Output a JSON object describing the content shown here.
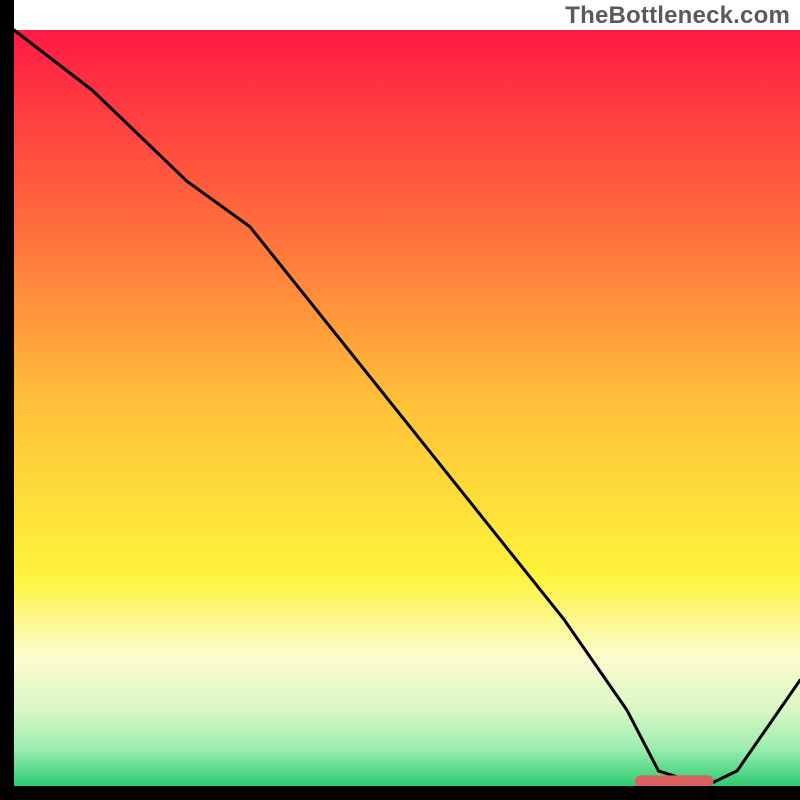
{
  "watermark": "TheBottleneck.com",
  "chart_data": {
    "type": "line",
    "title": "",
    "xlabel": "",
    "ylabel": "",
    "xlim": [
      0,
      100
    ],
    "ylim": [
      0,
      100
    ],
    "background_gradient": {
      "stops": [
        {
          "offset": 0,
          "color": "#ff1a44"
        },
        {
          "offset": 25,
          "color": "#ff6a3c"
        },
        {
          "offset": 50,
          "color": "#ffc23a"
        },
        {
          "offset": 72,
          "color": "#fef33a"
        },
        {
          "offset": 83,
          "color": "#fcfccf"
        },
        {
          "offset": 90,
          "color": "#d9f7c4"
        },
        {
          "offset": 95,
          "color": "#9dedb0"
        },
        {
          "offset": 100,
          "color": "#2ecb70"
        }
      ]
    },
    "series": [
      {
        "name": "curve",
        "color": "#000000",
        "stroke_width": 3,
        "x": [
          0,
          10,
          22,
          30,
          40,
          50,
          60,
          70,
          78,
          82,
          88,
          92,
          100
        ],
        "y": [
          100,
          92,
          80,
          74,
          61,
          48,
          35,
          22,
          10,
          2,
          0,
          2,
          14
        ]
      }
    ],
    "marker": {
      "name": "optimal-range",
      "color": "#d9615f",
      "x_start": 79,
      "x_end": 89,
      "y": 0.6,
      "thickness": 1.6
    },
    "axes": {
      "left": {
        "color": "#000000",
        "width": 14
      },
      "bottom": {
        "color": "#000000",
        "width": 14
      }
    }
  }
}
